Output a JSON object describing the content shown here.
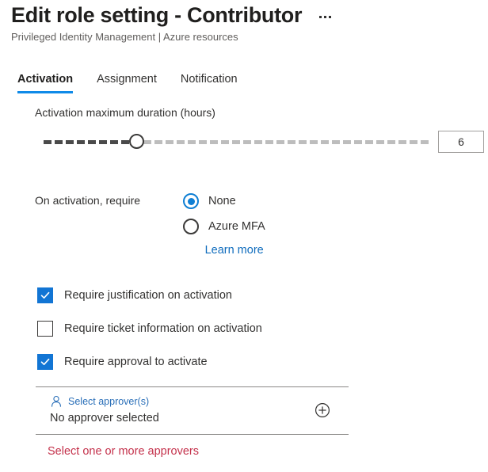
{
  "header": {
    "title": "Edit role setting - Contributor",
    "subtitle": "Privileged Identity Management | Azure resources",
    "more_icon": "ellipsis-icon"
  },
  "tabs": [
    {
      "label": "Activation",
      "active": true
    },
    {
      "label": "Assignment",
      "active": false
    },
    {
      "label": "Notification",
      "active": false
    }
  ],
  "duration": {
    "label": "Activation maximum duration (hours)",
    "value": "6",
    "min": 1,
    "max": 24,
    "fill_percent": 23
  },
  "activation_requirement": {
    "label": "On activation, require",
    "options": [
      {
        "label": "None",
        "selected": true
      },
      {
        "label": "Azure MFA",
        "selected": false
      }
    ],
    "learn_more": "Learn more"
  },
  "checkboxes": [
    {
      "label": "Require justification on activation",
      "checked": true
    },
    {
      "label": "Require ticket information on activation",
      "checked": false
    },
    {
      "label": "Require approval to activate",
      "checked": true
    }
  ],
  "approvers": {
    "picker_label": "Select approver(s)",
    "status": "No approver selected",
    "person_icon": "person-icon",
    "add_icon": "plus-circle-icon",
    "error": "Select one or more approvers"
  },
  "colors": {
    "accent": "#0f7fd4",
    "tab_underline": "#0f8ae8",
    "link": "#0f6cbd",
    "error": "#c4314b",
    "checkbox_fill": "#1275d4",
    "text": "#323130",
    "subtle_text": "#605e5c"
  }
}
